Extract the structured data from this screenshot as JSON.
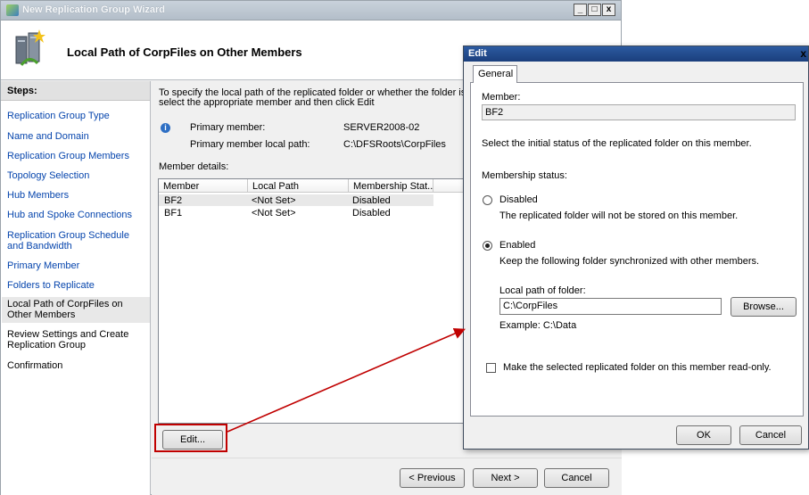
{
  "wizard": {
    "title": "New Replication Group Wizard",
    "header_title": "Local Path of CorpFiles on Other Members",
    "steps_heading": "Steps:",
    "steps": [
      {
        "label": "Replication Group Type"
      },
      {
        "label": "Name and Domain"
      },
      {
        "label": "Replication Group Members"
      },
      {
        "label": "Topology Selection"
      },
      {
        "label": "Hub Members"
      },
      {
        "label": "Hub and Spoke Connections"
      },
      {
        "label": "Replication Group Schedule and Bandwidth"
      },
      {
        "label": "Primary Member"
      },
      {
        "label": "Folders to Replicate"
      },
      {
        "label": "Local Path of CorpFiles on Other Members"
      },
      {
        "label": "Review Settings and Create Replication Group"
      },
      {
        "label": "Confirmation"
      }
    ],
    "instructions_line1": "To specify the local path of the replicated folder or whether the folder is read",
    "instructions_line2": "select the appropriate member and then click Edit",
    "primary_member_label": "Primary member:",
    "primary_member_value": "SERVER2008-02",
    "primary_path_label": "Primary member local path:",
    "primary_path_value": "C:\\DFSRoots\\CorpFiles",
    "member_details_label": "Member details:",
    "columns": [
      "Member",
      "Local Path",
      "Membership Stat..."
    ],
    "rows": [
      {
        "member": "BF2",
        "path": "<Not Set>",
        "status": "Disabled"
      },
      {
        "member": "BF1",
        "path": "<Not Set>",
        "status": "Disabled"
      }
    ],
    "edit_button": "Edit...",
    "previous_button": "< Previous",
    "next_button": "Next >",
    "cancel_button": "Cancel"
  },
  "edit_dialog": {
    "title": "Edit",
    "tab": "General",
    "member_label": "Member:",
    "member_value": "BF2",
    "initial_status_text": "Select the initial status of the replicated folder on this member.",
    "membership_status_label": "Membership status:",
    "disabled_label": "Disabled",
    "disabled_desc": "The replicated folder will not be stored on this member.",
    "enabled_label": "Enabled",
    "enabled_desc": "Keep the following folder synchronized with other members.",
    "local_path_label": "Local path of folder:",
    "local_path_value": "C:\\CorpFiles",
    "browse_button": "Browse...",
    "example_text": "Example: C:\\Data",
    "readonly_label": "Make the selected replicated folder on this member read-only.",
    "ok_button": "OK",
    "cancel_button": "Cancel",
    "selected_status": "Enabled",
    "readonly_checked": false
  },
  "annotation": {
    "color": "#c00000"
  }
}
